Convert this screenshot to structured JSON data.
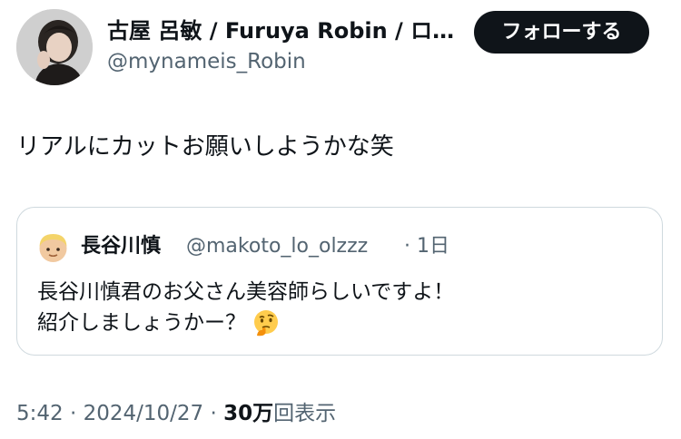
{
  "author": {
    "display_name": "古屋 呂敏 / Furuya Robin / ロ…",
    "handle": "@mynameis_Robin"
  },
  "follow_button": {
    "label": "フォローする"
  },
  "tweet": {
    "text": "リアルにカットお願いしようかな笑"
  },
  "quoted_tweet": {
    "display_name": "長谷川慎",
    "handle": "@makoto_lo_olzzz",
    "separator": "·",
    "time": "1日",
    "line1": "長谷川慎君のお父さん美容師らしいですよ！",
    "line2": "紹介しましょうかー？",
    "emoji_icon": "thinking-face-icon"
  },
  "meta": {
    "time": "5:42",
    "sep1": "·",
    "date": "2024/10/27",
    "sep2": "·",
    "views_count": "30万",
    "views_label": "回表示"
  },
  "colors": {
    "text_primary": "#0f1419",
    "text_secondary": "#536471",
    "border": "#cfd9de",
    "button_bg": "#0f1419"
  }
}
